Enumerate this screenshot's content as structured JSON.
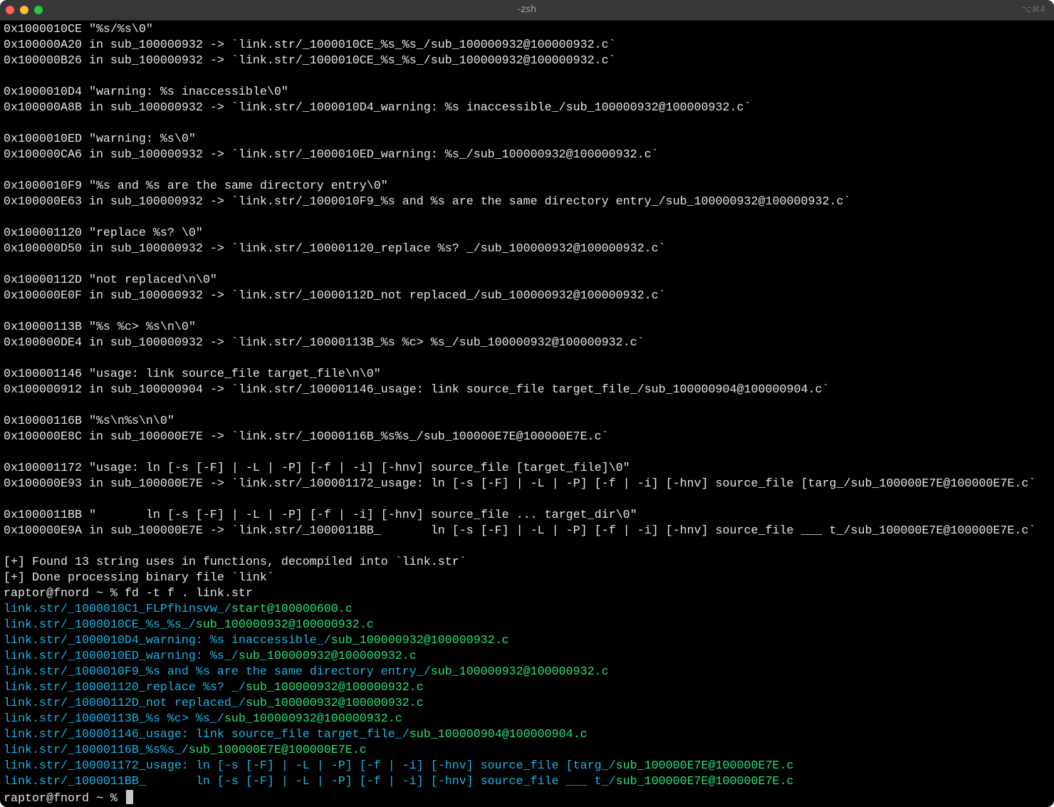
{
  "window": {
    "title": "-zsh",
    "shortcut": "⌥⌘4"
  },
  "lines": [
    {
      "text": "0x1000010CE \"%s/%s\\0\""
    },
    {
      "text": "0x100000A20 in sub_100000932 -> `link.str/_1000010CE_%s_%s_/sub_100000932@100000932.c`"
    },
    {
      "text": "0x100000B26 in sub_100000932 -> `link.str/_1000010CE_%s_%s_/sub_100000932@100000932.c`"
    },
    {
      "text": ""
    },
    {
      "text": "0x1000010D4 \"warning: %s inaccessible\\0\""
    },
    {
      "text": "0x100000A8B in sub_100000932 -> `link.str/_1000010D4_warning: %s inaccessible_/sub_100000932@100000932.c`"
    },
    {
      "text": ""
    },
    {
      "text": "0x1000010ED \"warning: %s\\0\""
    },
    {
      "text": "0x100000CA6 in sub_100000932 -> `link.str/_1000010ED_warning: %s_/sub_100000932@100000932.c`"
    },
    {
      "text": ""
    },
    {
      "text": "0x1000010F9 \"%s and %s are the same directory entry\\0\""
    },
    {
      "text": "0x100000E63 in sub_100000932 -> `link.str/_1000010F9_%s and %s are the same directory entry_/sub_100000932@100000932.c`"
    },
    {
      "text": ""
    },
    {
      "text": "0x100001120 \"replace %s? \\0\""
    },
    {
      "text": "0x100000D50 in sub_100000932 -> `link.str/_100001120_replace %s? _/sub_100000932@100000932.c`"
    },
    {
      "text": ""
    },
    {
      "text": "0x10000112D \"not replaced\\n\\0\""
    },
    {
      "text": "0x100000E0F in sub_100000932 -> `link.str/_10000112D_not replaced_/sub_100000932@100000932.c`"
    },
    {
      "text": ""
    },
    {
      "text": "0x10000113B \"%s %c> %s\\n\\0\""
    },
    {
      "text": "0x100000DE4 in sub_100000932 -> `link.str/_10000113B_%s %c> %s_/sub_100000932@100000932.c`"
    },
    {
      "text": ""
    },
    {
      "text": "0x100001146 \"usage: link source_file target_file\\n\\0\""
    },
    {
      "text": "0x100000912 in sub_100000904 -> `link.str/_100001146_usage: link source_file target_file_/sub_100000904@100000904.c`"
    },
    {
      "text": ""
    },
    {
      "text": "0x10000116B \"%s\\n%s\\n\\0\""
    },
    {
      "text": "0x100000E8C in sub_100000E7E -> `link.str/_10000116B_%s%s_/sub_100000E7E@100000E7E.c`"
    },
    {
      "text": ""
    },
    {
      "text": "0x100001172 \"usage: ln [-s [-F] | -L | -P] [-f | -i] [-hnv] source_file [target_file]\\0\""
    },
    {
      "text": "0x100000E93 in sub_100000E7E -> `link.str/_100001172_usage: ln [-s [-F] | -L | -P] [-f | -i] [-hnv] source_file [targ_/sub_100000E7E@100000E7E.c`"
    },
    {
      "text": ""
    },
    {
      "text": "0x1000011BB \"       ln [-s [-F] | -L | -P] [-f | -i] [-hnv] source_file ... target_dir\\0\""
    },
    {
      "text": "0x100000E9A in sub_100000E7E -> `link.str/_1000011BB_       ln [-s [-F] | -L | -P] [-f | -i] [-hnv] source_file ___ t_/sub_100000E7E@100000E7E.c`"
    },
    {
      "text": ""
    },
    {
      "text": "[+] Found 13 string uses in functions, decompiled into `link.str`"
    },
    {
      "text": "[+] Done processing binary file `link`"
    },
    {
      "text": "raptor@fnord ~ % fd -t f . link.str"
    },
    {
      "dir": "link.str/_1000010C1_FLPfhinsvw_/",
      "file": "start@100000600.c"
    },
    {
      "dir": "link.str/_1000010CE_%s_%s_/",
      "file": "sub_100000932@100000932.c"
    },
    {
      "dir": "link.str/_1000010D4_warning: %s inaccessible_/",
      "file": "sub_100000932@100000932.c"
    },
    {
      "dir": "link.str/_1000010ED_warning: %s_/",
      "file": "sub_100000932@100000932.c"
    },
    {
      "dir": "link.str/_1000010F9_%s and %s are the same directory entry_/",
      "file": "sub_100000932@100000932.c"
    },
    {
      "dir": "link.str/_100001120_replace %s? _/",
      "file": "sub_100000932@100000932.c"
    },
    {
      "dir": "link.str/_10000112D_not replaced_/",
      "file": "sub_100000932@100000932.c"
    },
    {
      "dir": "link.str/_10000113B_%s %c> %s_/",
      "file": "sub_100000932@100000932.c"
    },
    {
      "dir": "link.str/_100001146_usage: link source_file target_file_/",
      "file": "sub_100000904@100000904.c"
    },
    {
      "dir": "link.str/_10000116B_%s%s_/",
      "file": "sub_100000E7E@100000E7E.c"
    },
    {
      "dir": "link.str/_100001172_usage: ln [-s [-F] | -L | -P] [-f | -i] [-hnv] source_file [targ_/",
      "file": "sub_100000E7E@100000E7E.c"
    },
    {
      "dir": "link.str/_1000011BB_       ln [-s [-F] | -L | -P] [-f | -i] [-hnv] source_file ___ t_/",
      "file": "sub_100000E7E@100000E7E.c"
    }
  ],
  "prompt": "raptor@fnord ~ % "
}
